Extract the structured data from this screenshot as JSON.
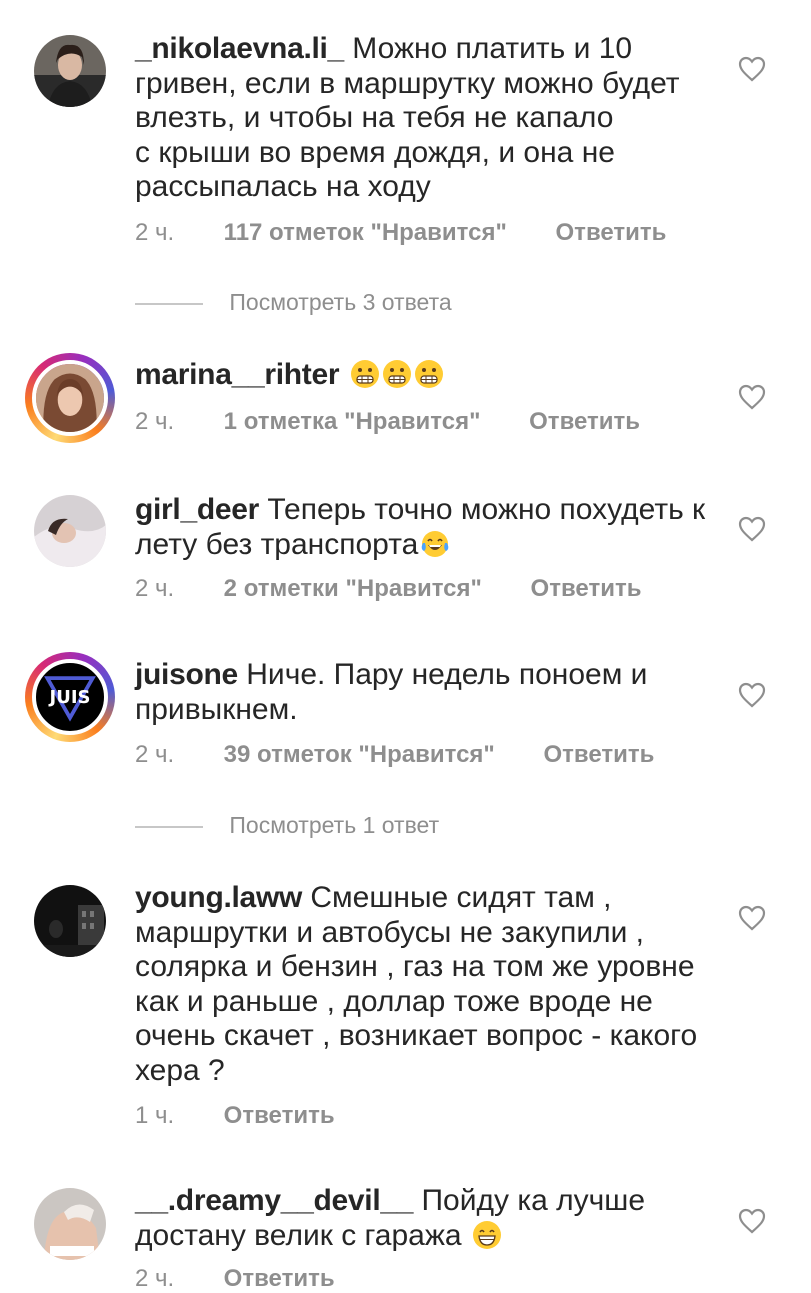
{
  "comments": [
    {
      "username": "_nikolaevna.li_",
      "text": "Можно платить и 10 гривен, если в маршрутку можно будет влезть, и чтобы на тебя не капало с крыши во время дождя, и она не рассыпалась на ходу",
      "lines": [
        "Можно платить и 10",
        "гривен, если в маршрутку можно будет",
        "влезть, и чтобы на тебя не капало",
        "с крыши во время дождя, и она не",
        "рассыпалась на ходу"
      ],
      "time": "2 ч.",
      "likes": "117 отметок \"Нравится\"",
      "reply": "Ответить",
      "view_replies": "Посмотреть 3 ответа",
      "avatar": "avatar-photo"
    },
    {
      "username": "marina__rihter",
      "text": "😬😬😬",
      "time": "2 ч.",
      "likes": "1 отметка \"Нравится\"",
      "reply": "Ответить",
      "avatar": "avatar-photo-story-ring"
    },
    {
      "username": "girl_deer",
      "text": "Теперь точно можно похудеть к лету без транспорта😂",
      "lines": [
        "Теперь точно можно похудеть к",
        "лету без транспорта"
      ],
      "time": "2 ч.",
      "likes": "2 отметки \"Нравится\"",
      "reply": "Ответить",
      "avatar": "avatar-photo"
    },
    {
      "username": "juisone",
      "text": "Ниче. Пару недель поноем и привыкнем.",
      "lines": [
        "Ниче. Пару недель поноем и",
        "привыкнем."
      ],
      "time": "2 ч.",
      "likes": "39 отметок \"Нравится\"",
      "reply": "Ответить",
      "view_replies": "Посмотреть 1 ответ",
      "avatar": "avatar-logo-story-ring",
      "avatar_text": "JUIS"
    },
    {
      "username": "young.laww",
      "text": "Смешные сидят там , маршрутки и автобусы не закупили , солярка и бензин , газ  на том же уровне как и раньше , доллар тоже вроде не очень скачет , возникает вопрос - какого хера ?",
      "lines": [
        "Смешные сидят там ,",
        "маршрутки и автобусы не закупили ,",
        "солярка и бензин , газ  на том же уровне",
        "как и раньше , доллар тоже вроде не",
        "очень скачет , возникает вопрос - какого",
        "хера ?"
      ],
      "time": "1 ч.",
      "reply": "Ответить",
      "avatar": "avatar-photo"
    },
    {
      "username": "__.dreamy__devil__",
      "text": "Пойду ка лучше достану велик с гаража 😁",
      "lines": [
        "Пойду ка лучше",
        "достану велик с гаража"
      ],
      "time": "2 ч.",
      "reply": "Ответить",
      "avatar": "avatar-photo"
    }
  ],
  "colors": {
    "text": "#262626",
    "secondary": "#8e8e8e",
    "divider": "#c7c7c7",
    "emoji": "#ffcc33"
  },
  "icons": [
    "heart-outline-icon",
    "grimacing-face-emoji",
    "tears-of-joy-emoji",
    "beaming-face-emoji"
  ]
}
